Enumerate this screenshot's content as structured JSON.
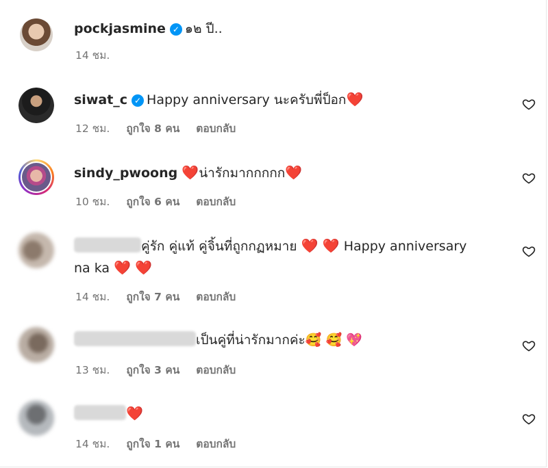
{
  "caption": {
    "username": "pockjasmine",
    "verified": true,
    "text": "๑๒ ปี..",
    "time": "14 ชม."
  },
  "comments": [
    {
      "username": "siwat_c",
      "verified": true,
      "text": "Happy anniversary นะครับพี่ป็อก",
      "emoji": "❤️",
      "time": "12 ชม.",
      "likes": "ถูกใจ 8 คน",
      "reply": "ตอบกลับ"
    },
    {
      "username": "sindy_pwoong",
      "verified": false,
      "emoji_pre": "❤️",
      "text": "น่ารักมากกกกก",
      "emoji": "❤️",
      "time": "10 ชม.",
      "likes": "ถูกใจ 6 คน",
      "reply": "ตอบกลับ"
    },
    {
      "username": "",
      "text": "คู่รัก คู่แท้ คู่จิ้นที่ถูกกฏหมาย",
      "emoji": "❤️ ❤️",
      "text2": "Happy anniversary",
      "text3": "na ka",
      "emoji2": "❤️ ❤️",
      "time": "14 ชม.",
      "likes": "ถูกใจ 7 คน",
      "reply": "ตอบกลับ"
    },
    {
      "username": "",
      "text": "เป็นคู่ที่น่ารักมากค่ะ",
      "emoji": "🥰 🥰 💖",
      "time": "13 ชม.",
      "likes": "ถูกใจ 3 คน",
      "reply": "ตอบกลับ"
    },
    {
      "username": "",
      "text": "",
      "emoji": "❤️",
      "time": "14 ชม.",
      "likes": "ถูกใจ 1 คน",
      "reply": "ตอบกลับ"
    }
  ],
  "icons": {
    "like": "heart-outline-icon",
    "verified": "verified-badge-icon"
  },
  "colors": {
    "verified": "#0095f6",
    "heart": "#e0245e",
    "meta": "#737373"
  }
}
